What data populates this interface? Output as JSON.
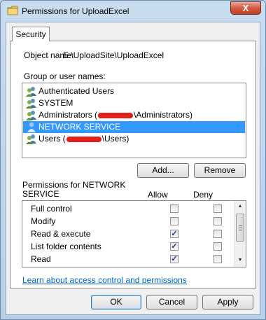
{
  "window": {
    "title": "Permissions for UploadExcel",
    "close_glyph": "X"
  },
  "tabs": [
    {
      "label": "Security"
    }
  ],
  "object": {
    "label": "Object name:",
    "value": "E:\\UploadSite\\UploadExcel"
  },
  "groups": {
    "label": "Group or user names:",
    "items": [
      {
        "pre": "Authenticated Users",
        "post": ""
      },
      {
        "pre": "SYSTEM",
        "post": ""
      },
      {
        "pre": "Administrators (",
        "post": "\\Administrators)"
      },
      {
        "pre": "NETWORK SERVICE",
        "post": ""
      },
      {
        "pre": "Users (",
        "post": "\\Users)"
      }
    ],
    "selected_index": 3
  },
  "buttons": {
    "add": "Add...",
    "remove": "Remove",
    "ok": "OK",
    "cancel": "Cancel",
    "apply": "Apply"
  },
  "permissions": {
    "title": "Permissions for NETWORK SERVICE",
    "allow_header": "Allow",
    "deny_header": "Deny",
    "rows": [
      {
        "name": "Full control",
        "allow": false,
        "deny": false
      },
      {
        "name": "Modify",
        "allow": false,
        "deny": false
      },
      {
        "name": "Read & execute",
        "allow": true,
        "deny": false
      },
      {
        "name": "List folder contents",
        "allow": true,
        "deny": false
      },
      {
        "name": "Read",
        "allow": true,
        "deny": false
      }
    ]
  },
  "link": {
    "text": "Learn about access control and permissions"
  },
  "icons": {
    "title_icon": "folder-icon",
    "user_icon": "user-group-icon"
  },
  "colors": {
    "selection": "#3399ff",
    "link": "#0066cc",
    "redaction": "#e2201a",
    "close": "#c13f27"
  }
}
